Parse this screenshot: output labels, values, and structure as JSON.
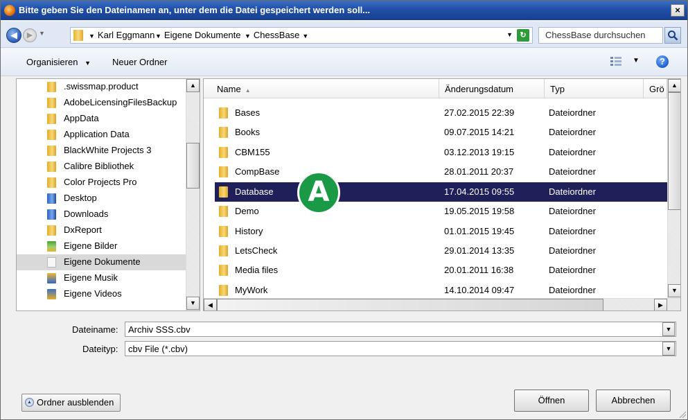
{
  "window": {
    "title": "Bitte geben Sie den Dateinamen an, unter dem die Datei gespeichert werden soll...",
    "close_glyph": "×"
  },
  "address": {
    "breadcrumbs": [
      "Karl Eggmann",
      "Eigene Dokumente",
      "ChessBase"
    ],
    "search_placeholder": "ChessBase durchsuchen"
  },
  "toolbar": {
    "organize_label": "Organisieren",
    "new_folder_label": "Neuer Ordner",
    "help_glyph": "?"
  },
  "navpane": {
    "items": [
      {
        "label": ".swissmap.product",
        "icon": "folder-icon"
      },
      {
        "label": "AdobeLicensingFilesBackup",
        "icon": "folder-icon"
      },
      {
        "label": "AppData",
        "icon": "folder-icon"
      },
      {
        "label": "Application Data",
        "icon": "folder-icon"
      },
      {
        "label": "BlackWhite Projects 3",
        "icon": "folder-icon"
      },
      {
        "label": "Calibre Bibliothek",
        "icon": "folder-icon"
      },
      {
        "label": "Color Projects Pro",
        "icon": "folder-icon"
      },
      {
        "label": "Desktop",
        "icon": "desktop-icon"
      },
      {
        "label": "Downloads",
        "icon": "downloads-icon"
      },
      {
        "label": "DxReport",
        "icon": "folder-icon"
      },
      {
        "label": "Eigene Bilder",
        "icon": "pictures-icon"
      },
      {
        "label": "Eigene Dokumente",
        "icon": "documents-icon",
        "selected": true
      },
      {
        "label": "Eigene Musik",
        "icon": "music-icon"
      },
      {
        "label": "Eigene Videos",
        "icon": "videos-icon"
      }
    ]
  },
  "filelist": {
    "columns": [
      "Name",
      "Änderungsdatum",
      "Typ",
      "Grö"
    ],
    "rows": [
      {
        "name": "Bases",
        "date": "27.02.2015 22:39",
        "type": "Dateiordner"
      },
      {
        "name": "Books",
        "date": "09.07.2015 14:21",
        "type": "Dateiordner"
      },
      {
        "name": "CBM155",
        "date": "03.12.2013 19:15",
        "type": "Dateiordner"
      },
      {
        "name": "CompBase",
        "date": "28.01.2011 20:37",
        "type": "Dateiordner"
      },
      {
        "name": "Database",
        "date": "17.04.2015 09:55",
        "type": "Dateiordner",
        "selected": true
      },
      {
        "name": "Demo",
        "date": "19.05.2015 19:58",
        "type": "Dateiordner"
      },
      {
        "name": "History",
        "date": "01.01.2015 19:45",
        "type": "Dateiordner"
      },
      {
        "name": "LetsCheck",
        "date": "29.01.2014 13:35",
        "type": "Dateiordner"
      },
      {
        "name": "Media files",
        "date": "20.01.2011 16:38",
        "type": "Dateiordner"
      },
      {
        "name": "MyWork",
        "date": "14.10.2014 09:47",
        "type": "Dateiordner"
      }
    ]
  },
  "annotation": {
    "marker_label": "A",
    "color": "#1a9a47"
  },
  "form": {
    "filename_label": "Dateiname:",
    "filename_value": "Archiv SSS.cbv",
    "filetype_label": "Dateityp:",
    "filetype_value": "cbv File (*.cbv)"
  },
  "buttons": {
    "hide_folders_label": "Ordner ausblenden",
    "open_label": "Öffnen",
    "cancel_label": "Abbrechen"
  },
  "colors": {
    "selection": "#1f1f5a",
    "title_bar": "#1f4fa8"
  }
}
